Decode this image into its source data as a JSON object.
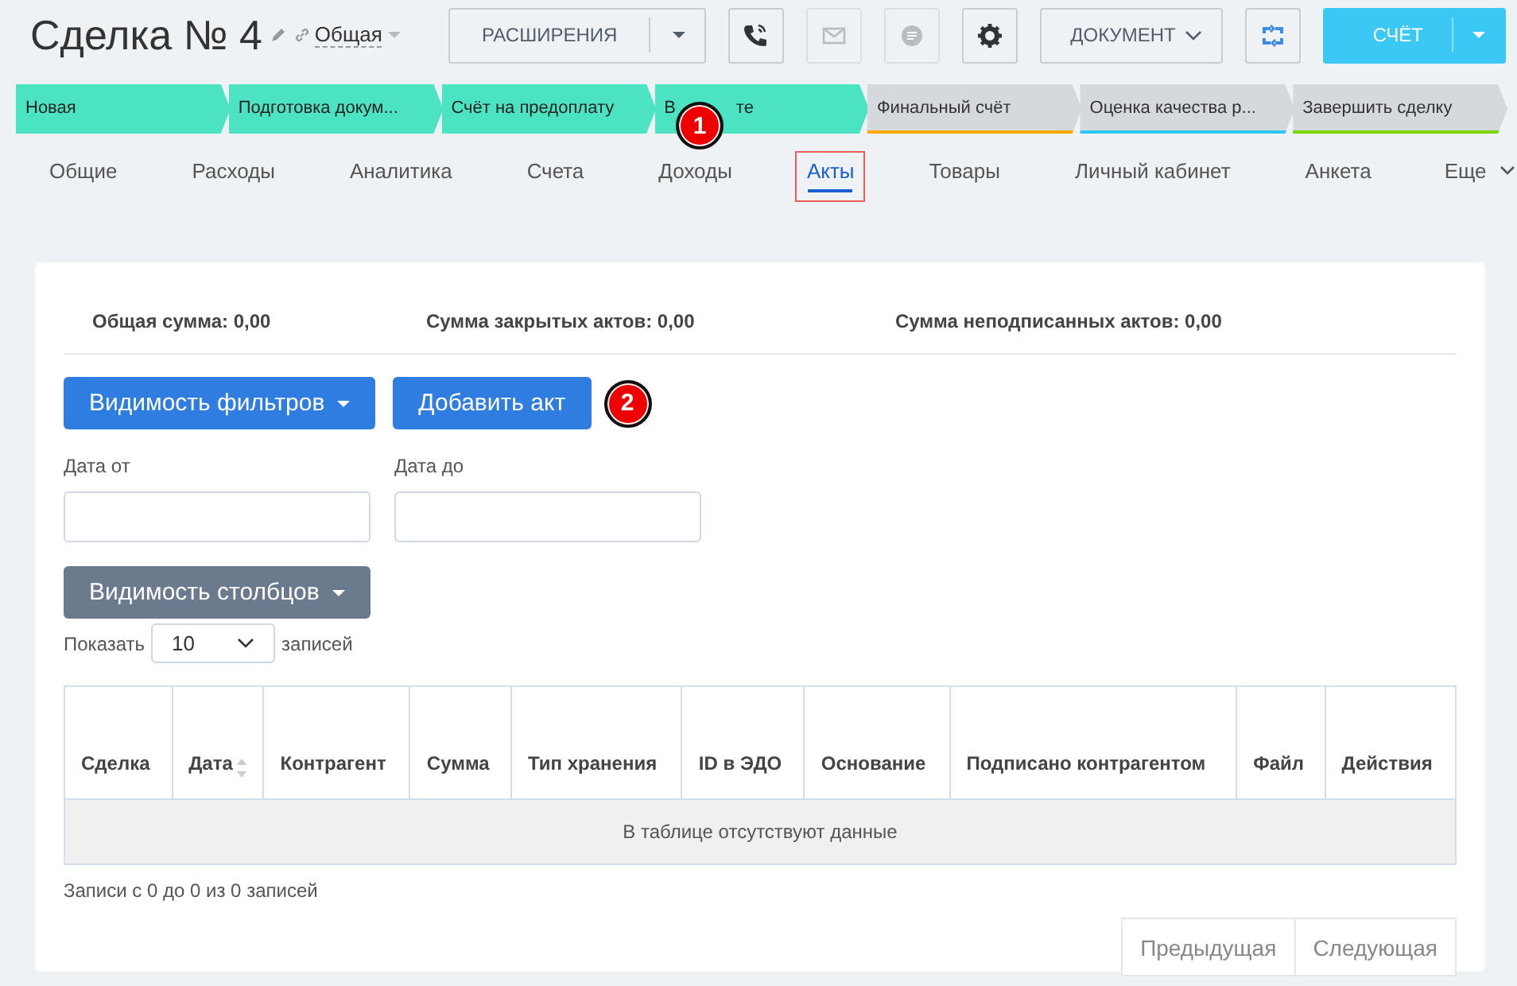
{
  "header": {
    "title": "Сделка № 4",
    "category": "Общая",
    "buttons": [
      {
        "kind": "split",
        "label": "РАСШИРЕНИЯ"
      },
      {
        "kind": "icon",
        "disabled": false
      },
      {
        "kind": "icon",
        "disabled": true
      },
      {
        "kind": "icon",
        "disabled": true
      },
      {
        "kind": "icon",
        "disabled": false
      },
      {
        "kind": "dropdown",
        "label": "ДОКУМЕНТ"
      },
      {
        "kind": "icon",
        "disabled": false
      },
      {
        "kind": "primary",
        "label": "СЧЁТ"
      }
    ]
  },
  "stages": [
    {
      "label": "Новая",
      "done": true,
      "color": "#4be3c2"
    },
    {
      "label": "Подготовка докум...",
      "done": true,
      "color": "#4be3c2"
    },
    {
      "label": "Счёт на предоплату",
      "done": true,
      "color": "#4be3c2"
    },
    {
      "label": "В",
      "label_end": "те",
      "done": true,
      "color": "#4be3c2"
    },
    {
      "label": "Финальный счёт",
      "done": false,
      "color": "#ffa900"
    },
    {
      "label": "Оценка качества р...",
      "done": false,
      "color": "#2fc6f6"
    },
    {
      "label": "Завершить сделку",
      "done": false,
      "color": "#7bd500"
    }
  ],
  "tabs": [
    {
      "label": "Общие",
      "selected": false
    },
    {
      "label": "Расходы",
      "selected": false
    },
    {
      "label": "Аналитика",
      "selected": false
    },
    {
      "label": "Счета",
      "selected": false
    },
    {
      "label": "Доходы",
      "selected": false
    },
    {
      "label": "Акты",
      "selected": true
    },
    {
      "label": "Товары",
      "selected": false
    },
    {
      "label": "Личный кабинет",
      "selected": false
    },
    {
      "label": "Анкета",
      "selected": false
    }
  ],
  "more_tab": "Еще",
  "callouts": [
    "1",
    "2"
  ],
  "summary": [
    "Общая сумма: 0,00",
    "Сумма закрытых актов: 0,00",
    "Сумма неподписанных актов: 0,00"
  ],
  "buttons": {
    "filters": "Видимость фильтров",
    "add": "Добавить акт",
    "columns": "Видимость столбцов"
  },
  "filters": [
    {
      "label": "Дата от"
    },
    {
      "label": "Дата до"
    }
  ],
  "page_size": {
    "before": "Показать",
    "value": "10",
    "after": "записей"
  },
  "table": {
    "columns": [
      {
        "label": "Сделка",
        "sortable": false
      },
      {
        "label": "Дата",
        "sortable": true
      },
      {
        "label": "Контрагент",
        "sortable": false
      },
      {
        "label": "Сумма",
        "sortable": false
      },
      {
        "label": "Тип хранения",
        "sortable": false
      },
      {
        "label": "ID в ЭДО",
        "sortable": false
      },
      {
        "label": "Основание",
        "sortable": false
      },
      {
        "label": "Подписано контрагентом",
        "sortable": false
      },
      {
        "label": "Файл",
        "sortable": false
      },
      {
        "label": "Действия",
        "sortable": false
      }
    ],
    "empty": "В таблице отсутствуют данные"
  },
  "info": "Записи с 0 до 0 из 0 записей",
  "pagination": [
    "Предыдущая",
    "Следующая"
  ]
}
